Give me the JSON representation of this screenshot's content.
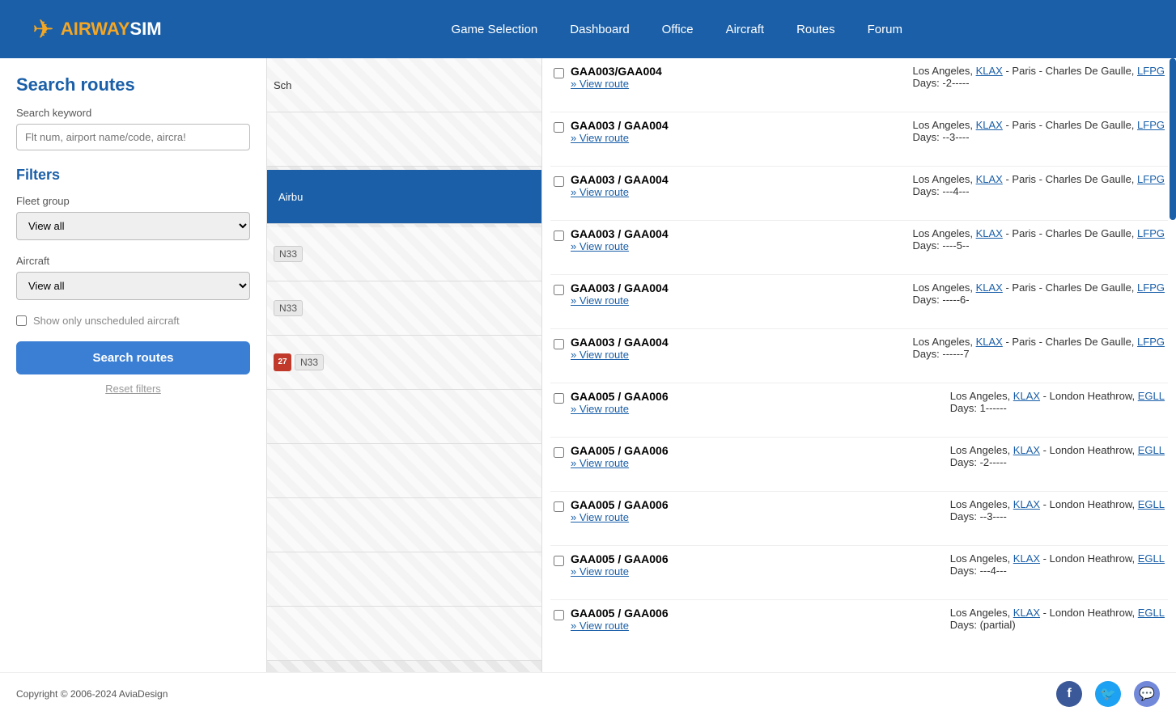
{
  "header": {
    "logo_airway": "AIRWAY",
    "logo_sim": "SIM",
    "nav_items": [
      {
        "label": "Game Selection"
      },
      {
        "label": "Dashboard"
      },
      {
        "label": "Office"
      },
      {
        "label": "Aircraft"
      },
      {
        "label": "Routes"
      },
      {
        "label": "Forum"
      }
    ]
  },
  "sidebar": {
    "title": "Search routes",
    "keyword_label": "Search keyword",
    "keyword_placeholder": "Flt num, airport name/code, aircra!",
    "filters_title": "Filters",
    "fleet_group_label": "Fleet group",
    "fleet_group_default": "View all",
    "aircraft_label": "Aircraft",
    "aircraft_default": "View all",
    "unscheduled_label": "Show only unscheduled aircraft",
    "search_button": "Search routes",
    "reset_link": "Reset filters"
  },
  "schedule_panel": {
    "label": "Sch",
    "items": [
      {
        "type": "empty"
      },
      {
        "type": "airbus_btn",
        "label": "Airbu"
      },
      {
        "type": "n33",
        "text": "N33"
      },
      {
        "type": "n33",
        "text": "N33"
      },
      {
        "type": "calendar_n33",
        "text": "N33",
        "day": "27"
      }
    ]
  },
  "routes": [
    {
      "id": "GAA003/GAA004",
      "from_city": "Los Angeles",
      "from_code": "KLAX",
      "to_city": "Paris - Charles De Gaulle",
      "to_code": "LFPG",
      "view_route_label": "» View route",
      "days": "Days: -2-----"
    },
    {
      "id": "GAA003 / GAA004",
      "from_city": "Los Angeles",
      "from_code": "KLAX",
      "to_city": "Paris - Charles De Gaulle",
      "to_code": "LFPG",
      "view_route_label": "» View route",
      "days": "Days: --3----"
    },
    {
      "id": "GAA003 / GAA004",
      "from_city": "Los Angeles",
      "from_code": "KLAX",
      "to_city": "Paris - Charles De Gaulle",
      "to_code": "LFPG",
      "view_route_label": "» View route",
      "days": "Days: ---4---"
    },
    {
      "id": "GAA003 / GAA004",
      "from_city": "Los Angeles",
      "from_code": "KLAX",
      "to_city": "Paris - Charles De Gaulle",
      "to_code": "LFPG",
      "view_route_label": "» View route",
      "days": "Days: ----5--"
    },
    {
      "id": "GAA003 / GAA004",
      "from_city": "Los Angeles",
      "from_code": "KLAX",
      "to_city": "Paris - Charles De Gaulle",
      "to_code": "LFPG",
      "view_route_label": "» View route",
      "days": "Days: -----6-"
    },
    {
      "id": "GAA003 / GAA004",
      "from_city": "Los Angeles",
      "from_code": "KLAX",
      "to_city": "Paris - Charles De Gaulle",
      "to_code": "LFPG",
      "view_route_label": "» View route",
      "days": "Days: ------7"
    },
    {
      "id": "GAA005 / GAA006",
      "from_city": "Los Angeles",
      "from_code": "KLAX",
      "to_city": "London Heathrow",
      "to_code": "EGLL",
      "view_route_label": "» View route",
      "days": "Days: 1------"
    },
    {
      "id": "GAA005 / GAA006",
      "from_city": "Los Angeles",
      "from_code": "KLAX",
      "to_city": "London Heathrow",
      "to_code": "EGLL",
      "view_route_label": "» View route",
      "days": "Days: -2-----"
    },
    {
      "id": "GAA005 / GAA006",
      "from_city": "Los Angeles",
      "from_code": "KLAX",
      "to_city": "London Heathrow",
      "to_code": "EGLL",
      "view_route_label": "» View route",
      "days": "Days: --3----"
    },
    {
      "id": "GAA005 / GAA006",
      "from_city": "Los Angeles",
      "from_code": "KLAX",
      "to_city": "London Heathrow",
      "to_code": "EGLL",
      "view_route_label": "» View route",
      "days": "Days: ---4---"
    },
    {
      "id": "GAA005 / GAA006",
      "from_city": "Los Angeles",
      "from_code": "KLAX",
      "to_city": "London Heathrow",
      "to_code": "EGLL",
      "view_route_label": "» View route",
      "days": "Days: (partial)"
    }
  ],
  "footer": {
    "copyright": "Copyright © 2006-2024 AviaDesign",
    "social": [
      {
        "name": "Facebook",
        "icon": "f"
      },
      {
        "name": "Twitter",
        "icon": "t"
      },
      {
        "name": "Discord",
        "icon": "d"
      }
    ]
  }
}
